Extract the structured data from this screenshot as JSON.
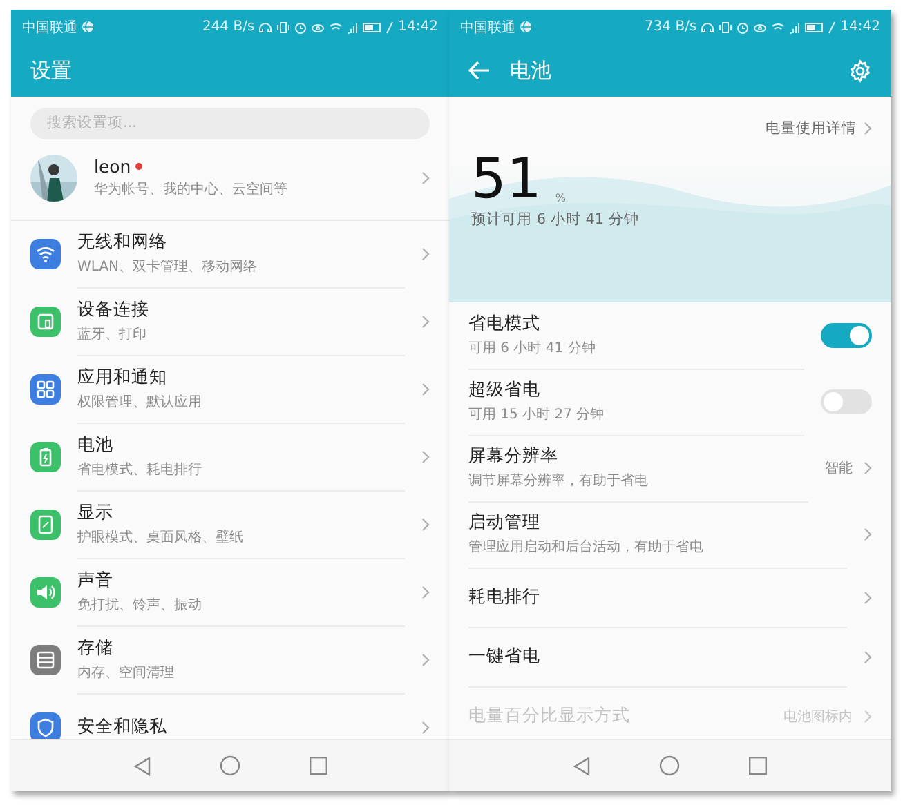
{
  "settings_screen": {
    "status_bar": {
      "carrier": "中国联通",
      "speed": "244 B/s",
      "time": "14:42"
    },
    "title": "设置",
    "search": {
      "placeholder": "搜索设置项..."
    },
    "account": {
      "name": "leon",
      "subtitle": "华为帐号、我的中心、云空间等",
      "notification_dot": true
    },
    "items": [
      {
        "title": "无线和网络",
        "subtitle": "WLAN、双卡管理、移动网络",
        "color": "#3d7fe0"
      },
      {
        "title": "设备连接",
        "subtitle": "蓝牙、打印",
        "color": "#3cc06a"
      },
      {
        "title": "应用和通知",
        "subtitle": "权限管理、默认应用",
        "color": "#3d7fe0"
      },
      {
        "title": "电池",
        "subtitle": "省电模式、耗电排行",
        "color": "#3cc06a"
      },
      {
        "title": "显示",
        "subtitle": "护眼模式、桌面风格、壁纸",
        "color": "#3cc06a"
      },
      {
        "title": "声音",
        "subtitle": "免打扰、铃声、振动",
        "color": "#3cc06a"
      },
      {
        "title": "存储",
        "subtitle": "内存、空间清理",
        "color": "#7d7d7d"
      },
      {
        "title": "安全和隐私",
        "color": "#3d7fe0"
      }
    ]
  },
  "battery_screen": {
    "status_bar": {
      "carrier": "中国联通",
      "speed": "734 B/s",
      "time": "14:42"
    },
    "title": "电池",
    "details_link": "电量使用详情",
    "level_value": "51",
    "level_unit": "%",
    "estimate": "预计可用 6 小时 41 分钟",
    "rows": [
      {
        "kind": "toggle",
        "title": "省电模式",
        "subtitle": "可用 6 小时 41 分钟",
        "on": true,
        "disabled": false
      },
      {
        "kind": "toggle",
        "title": "超级省电",
        "subtitle": "可用 15 小时 27 分钟",
        "on": false,
        "disabled": false
      },
      {
        "kind": "link",
        "title": "屏幕分辨率",
        "subtitle": "调节屏幕分辨率，有助于省电",
        "value": "智能",
        "disabled": false
      },
      {
        "kind": "link",
        "title": "启动管理",
        "subtitle": "管理应用启动和后台活动，有助于省电",
        "disabled": false
      },
      {
        "kind": "link",
        "title": "耗电排行",
        "disabled": false
      },
      {
        "kind": "link",
        "title": "一键省电",
        "disabled": false
      },
      {
        "kind": "link",
        "title": "电量百分比显示方式",
        "value": "电池图标内",
        "disabled": true
      }
    ]
  }
}
